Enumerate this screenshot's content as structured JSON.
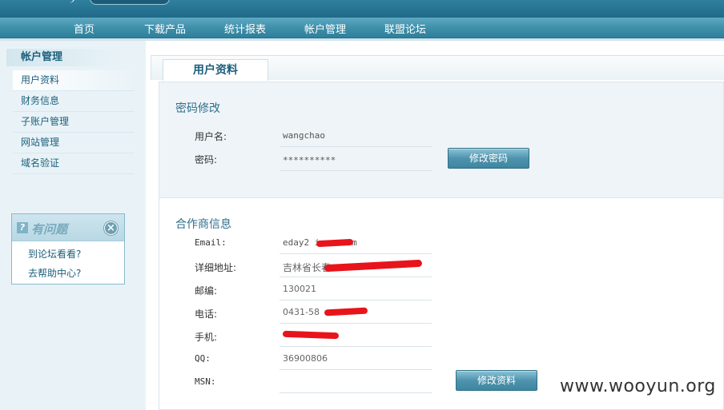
{
  "nav": {
    "items": [
      "首页",
      "下载产品",
      "统计报表",
      "帐户管理",
      "联盟论坛"
    ]
  },
  "sidebar": {
    "title": "帐户管理",
    "items": [
      {
        "label": "用户资料",
        "active": true
      },
      {
        "label": "财务信息"
      },
      {
        "label": "子账户管理"
      },
      {
        "label": "网站管理"
      },
      {
        "label": "域名验证"
      }
    ],
    "help": {
      "title": "有问题",
      "links": [
        "到论坛看看?",
        "去帮助中心?"
      ],
      "icons": [
        "question-icon",
        "close-icon"
      ]
    }
  },
  "main": {
    "tab": "用户资料",
    "password_panel": {
      "title": "密码修改",
      "rows": [
        {
          "label": "用户名:",
          "value": "wangchao"
        },
        {
          "label": "密码:",
          "value": "**********"
        }
      ],
      "button": "修改密码"
    },
    "info_panel": {
      "title": "合作商信息",
      "rows": [
        {
          "label": "Email:",
          "value": "eday2          ina. com"
        },
        {
          "label": "详细地址:",
          "value": "吉林省长春"
        },
        {
          "label": "邮编:",
          "value": "130021"
        },
        {
          "label": "电话:",
          "value": "0431-58"
        },
        {
          "label": "手机:",
          "value": ""
        },
        {
          "label": "QQ:",
          "value": "36900806"
        },
        {
          "label": "MSN:",
          "value": ""
        }
      ],
      "button": "修改资料"
    }
  },
  "watermark": "www.wooyun.org",
  "colors": {
    "nav_bg": "#3d8ea9",
    "accent": "#1c5f7d",
    "redaction": "#e8141b"
  }
}
